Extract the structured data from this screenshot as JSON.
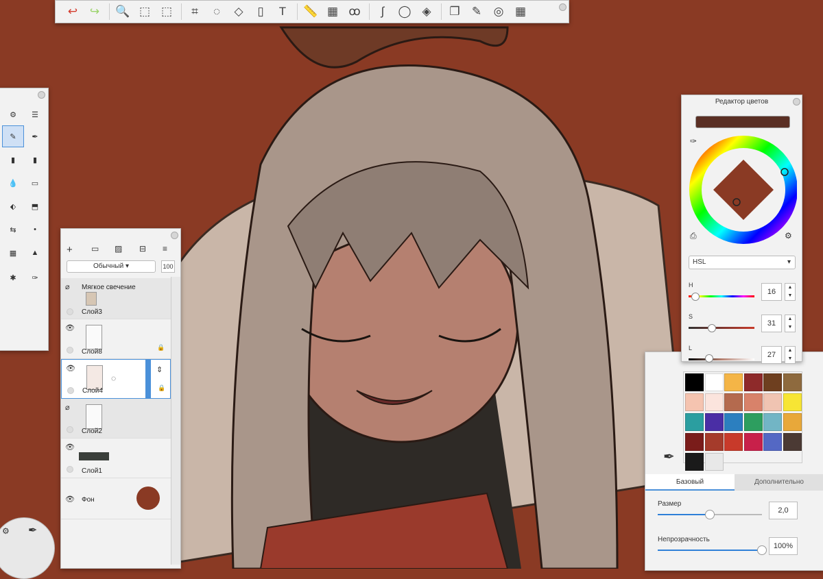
{
  "toolbar": {
    "tools": [
      {
        "name": "undo-icon",
        "glyph": "↩",
        "color": "#d33a2c"
      },
      {
        "name": "redo-icon",
        "glyph": "↪",
        "color": "#9ad36a"
      },
      {
        "name": "zoom-icon",
        "glyph": "🔍"
      },
      {
        "name": "select-icon",
        "glyph": "⬚"
      },
      {
        "name": "selection-mask-icon",
        "glyph": "⬚"
      },
      {
        "name": "crop-icon",
        "glyph": "⌗"
      },
      {
        "name": "lasso-transform-icon",
        "glyph": "◌"
      },
      {
        "name": "distort-icon",
        "glyph": "◇"
      },
      {
        "name": "bucket-icon",
        "glyph": "▯"
      },
      {
        "name": "text-icon",
        "glyph": "T"
      },
      {
        "name": "ruler-icon",
        "glyph": "📏"
      },
      {
        "name": "perspective-icon",
        "glyph": "▦"
      },
      {
        "name": "symmetry-icon",
        "glyph": "ꝏ"
      },
      {
        "name": "curve-icon",
        "glyph": "∫"
      },
      {
        "name": "ellipse-icon",
        "glyph": "◯"
      },
      {
        "name": "shapes-icon",
        "glyph": "◈"
      },
      {
        "name": "copy-layers-icon",
        "glyph": "❐"
      },
      {
        "name": "brushes-icon",
        "glyph": "✎"
      },
      {
        "name": "color-wheel-icon",
        "glyph": "◎"
      },
      {
        "name": "grid-menu-icon",
        "glyph": "▦"
      }
    ]
  },
  "layers": {
    "blend_mode": "Обычный",
    "opacity": "100",
    "items": [
      {
        "effect": "Мягкое свечение",
        "name": "Слой3"
      },
      {
        "name": "Слой8"
      },
      {
        "name": "Слой4"
      },
      {
        "name": "Слой2"
      },
      {
        "name": "Слой1"
      },
      {
        "name": "Фон",
        "color": "#8a3a24"
      }
    ]
  },
  "color_editor": {
    "title": "Редактор цветов",
    "current_color": "#5a2f24",
    "mode": "HSL",
    "h": "16",
    "s": "31",
    "l": "27"
  },
  "palette": [
    "#000000",
    "#ffffff",
    "#f4b547",
    "#8e2a2a",
    "#6e3f1f",
    "#8e6a3e",
    "#f5c4b0",
    "#fbe4dd",
    "#b46a4e",
    "#d8826a",
    "#f0c4b2",
    "#f7e534",
    "#2b9ea0",
    "#4a2ea5",
    "#2c7fbf",
    "#2d9e5f",
    "#72b5c5",
    "#e8a83a",
    "#7a1c1a",
    "#a53b2b",
    "#c83a2a",
    "#c8204a",
    "#5468c4",
    "#4b3a34",
    "#1a1a1a",
    "#e8e8e8"
  ],
  "brush_props": {
    "tab_basic": "Базовый",
    "tab_advanced": "Дополнительно",
    "size_label": "Размер",
    "size_value": "2,0",
    "size_level": 0.5,
    "opacity_label": "Непрозрачность",
    "opacity_value": "100%",
    "opacity_level": 1.0
  }
}
